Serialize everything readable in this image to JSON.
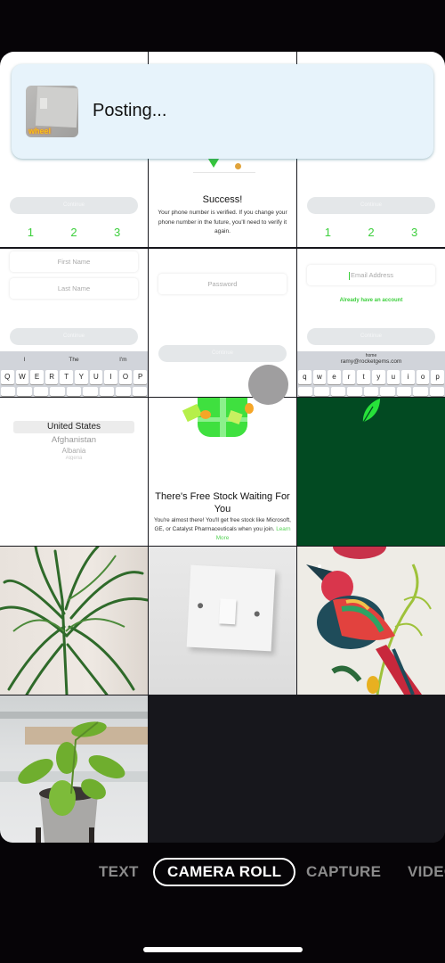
{
  "banner": {
    "status_text": "Posting...",
    "thumbnail_sticker": "wheel"
  },
  "grid": {
    "tile_signup_step": {
      "continue_label": "Continue",
      "steps": [
        "1",
        "2",
        "3"
      ]
    },
    "tile_success": {
      "title": "Success!",
      "body": "Your phone number is verified. If you change your phone number in the future, you'll need to verify it again."
    },
    "tile_signup_step_2": {
      "continue_label": "Continue",
      "steps": [
        "1",
        "2",
        "3"
      ]
    },
    "tile_name": {
      "first_name_placeholder": "First Name",
      "last_name_placeholder": "Last Name",
      "continue_label": "Continue",
      "suggestions": [
        "I",
        "The",
        "I'm"
      ],
      "keys": [
        "Q",
        "W",
        "E",
        "R",
        "T",
        "Y",
        "U",
        "I",
        "O",
        "P"
      ]
    },
    "tile_password": {
      "password_placeholder": "Password",
      "continue_label": "Continue"
    },
    "tile_email": {
      "email_placeholder": "Email Address",
      "already_link": "Already have an account",
      "continue_label": "Continue",
      "suggestion_label": "home",
      "suggestion_email": "ramy@rocketgems.com",
      "keys": [
        "q",
        "w",
        "e",
        "r",
        "t",
        "y",
        "u",
        "i",
        "o",
        "p"
      ]
    },
    "tile_country": {
      "options": [
        "United States",
        "Afghanistan",
        "Albania",
        "Algeria"
      ],
      "selected": "United States"
    },
    "tile_free_stock": {
      "title": "There's Free Stock Waiting For You",
      "body": "You're almost there! You'll get free stock like Microsoft, GE, or Catalyst Pharmaceuticals when you join.",
      "link": "Learn More"
    },
    "photos": [
      {
        "subject": "dracaena plant"
      },
      {
        "subject": "light switch"
      },
      {
        "subject": "folk art bird"
      },
      {
        "subject": "pothos plant on windowsill"
      }
    ]
  },
  "modes": {
    "items": [
      "TEXT",
      "CAMERA ROLL",
      "CAPTURE",
      "VIDEO"
    ],
    "active": "CAMERA ROLL"
  },
  "colors": {
    "accent_green": "#3ccf3c",
    "dark_green_tile": "#024a22",
    "banner_bg": "#e7f3fb"
  }
}
